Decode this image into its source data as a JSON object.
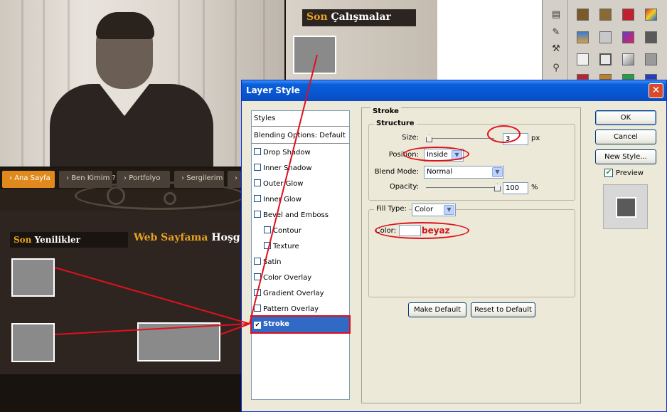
{
  "website": {
    "panel_title_accent": "Son",
    "panel_title_rest": "Çalışmalar",
    "nav": [
      "Ana Sayfa",
      "Ben Kimim ?",
      "Portfolyo",
      "Sergilerim"
    ],
    "section_title_accent": "Son",
    "section_title_rest": "Yenilikler",
    "welcome_accent": "Web Sayfama",
    "welcome_rest": "Hoşg"
  },
  "dialog": {
    "title": "Layer Style",
    "styles_header": "Styles",
    "blending_options": "Blending Options: Default",
    "style_items": [
      {
        "label": "Drop Shadow",
        "checked": false
      },
      {
        "label": "Inner Shadow",
        "checked": false
      },
      {
        "label": "Outer Glow",
        "checked": false
      },
      {
        "label": "Inner Glow",
        "checked": false
      },
      {
        "label": "Bevel and Emboss",
        "checked": false
      },
      {
        "label": "Contour",
        "checked": false
      },
      {
        "label": "Texture",
        "checked": false
      },
      {
        "label": "Satin",
        "checked": false
      },
      {
        "label": "Color Overlay",
        "checked": false
      },
      {
        "label": "Gradient Overlay",
        "checked": false
      },
      {
        "label": "Pattern Overlay",
        "checked": false
      },
      {
        "label": "Stroke",
        "checked": true
      }
    ],
    "stroke": {
      "section": "Stroke",
      "structure": "Structure",
      "size_label": "Size:",
      "size_value": "3",
      "size_unit": "px",
      "position_label": "Position:",
      "position_value": "Inside",
      "blend_label": "Blend Mode:",
      "blend_value": "Normal",
      "opacity_label": "Opacity:",
      "opacity_value": "100",
      "opacity_unit": "%",
      "fill_type_label": "Fill Type:",
      "fill_type_value": "Color",
      "color_label": "Color:"
    },
    "buttons": {
      "make_default": "Make Default",
      "reset_default": "Reset to Default",
      "ok": "OK",
      "cancel": "Cancel",
      "new_style": "New Style...",
      "preview": "Preview"
    }
  },
  "annotation": {
    "color_note": "beyaz"
  },
  "colors": {
    "accent_orange": "#e8a221",
    "annotation_red": "#e0101c",
    "xp_blue": "#0a5fd8",
    "selection_blue": "#316ac5"
  }
}
